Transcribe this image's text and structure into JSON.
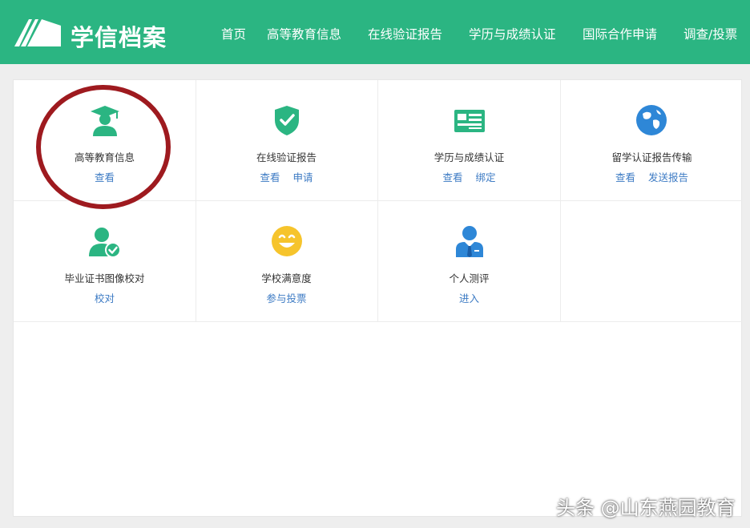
{
  "header": {
    "logo_text": "学信档案",
    "nav": [
      "首页",
      "高等教育信息",
      "在线验证报告",
      "学历与成绩认证",
      "国际合作申请",
      "调查/投票"
    ]
  },
  "cards": [
    {
      "title": "高等教育信息",
      "links": [
        "查看"
      ],
      "icon": "graduate-icon"
    },
    {
      "title": "在线验证报告",
      "links": [
        "查看",
        "申请"
      ],
      "icon": "shield-check-icon"
    },
    {
      "title": "学历与成绩认证",
      "links": [
        "查看",
        "绑定"
      ],
      "icon": "certificate-icon"
    },
    {
      "title": "留学认证报告传输",
      "links": [
        "查看",
        "发送报告"
      ],
      "icon": "globe-icon"
    },
    {
      "title": "毕业证书图像校对",
      "links": [
        "校对"
      ],
      "icon": "user-check-icon"
    },
    {
      "title": "学校满意度",
      "links": [
        "参与投票"
      ],
      "icon": "smiley-icon"
    },
    {
      "title": "个人测评",
      "links": [
        "进入"
      ],
      "icon": "person-tie-icon"
    }
  ],
  "watermark": "头条 @山东燕园教育",
  "colors": {
    "header": "#2bb582",
    "link": "#3d7bc4",
    "icon_green": "#2bb582",
    "icon_blue": "#2e87d7",
    "smiley": "#f6c42c",
    "highlight_circle": "#9e1a1f"
  }
}
